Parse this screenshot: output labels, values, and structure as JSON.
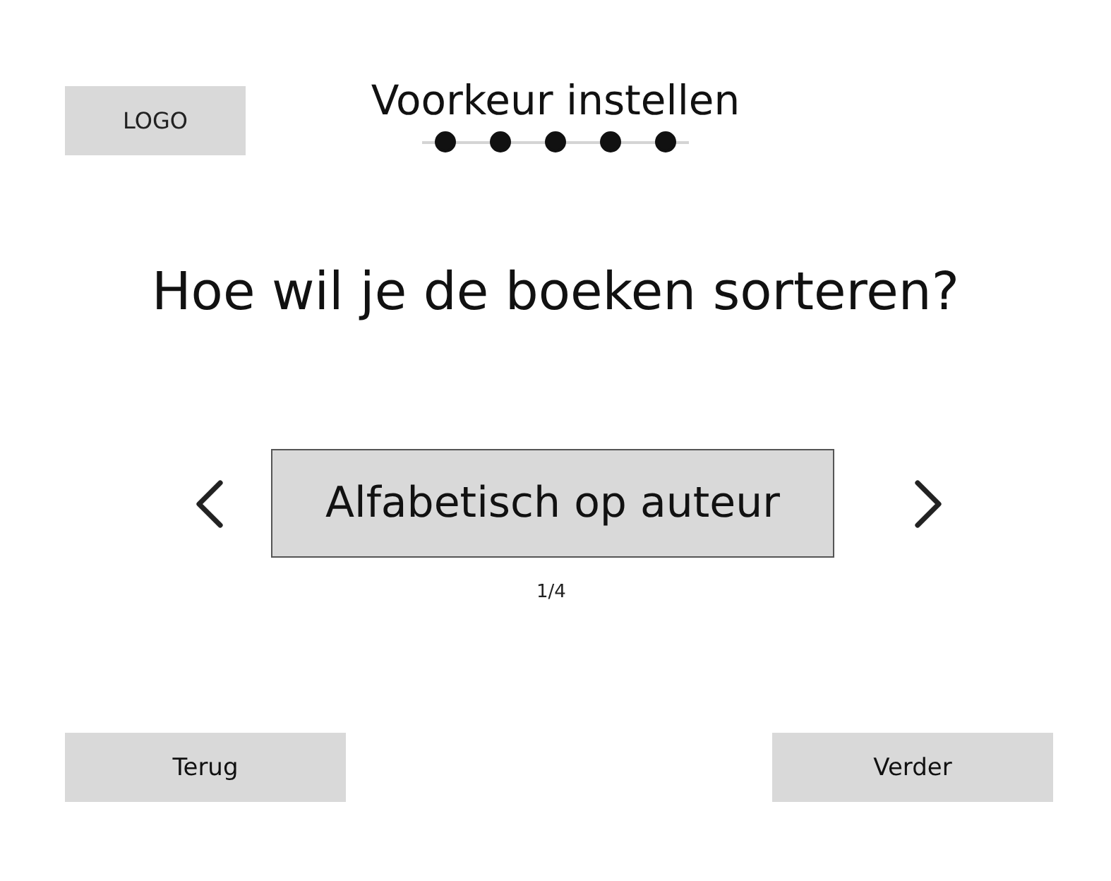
{
  "header": {
    "logo": "LOGO",
    "title": "Voorkeur instellen",
    "steps": [
      {
        "done": true
      },
      {
        "done": true
      },
      {
        "done": true
      },
      {
        "done": true
      },
      {
        "done": true
      }
    ]
  },
  "question": "Hoe wil je de boeken sorteren?",
  "carousel": {
    "option": "Alfabetisch op auteur",
    "counter": "1/4"
  },
  "buttons": [
    {
      "label": "Terug"
    },
    {
      "label": "Verder"
    }
  ]
}
